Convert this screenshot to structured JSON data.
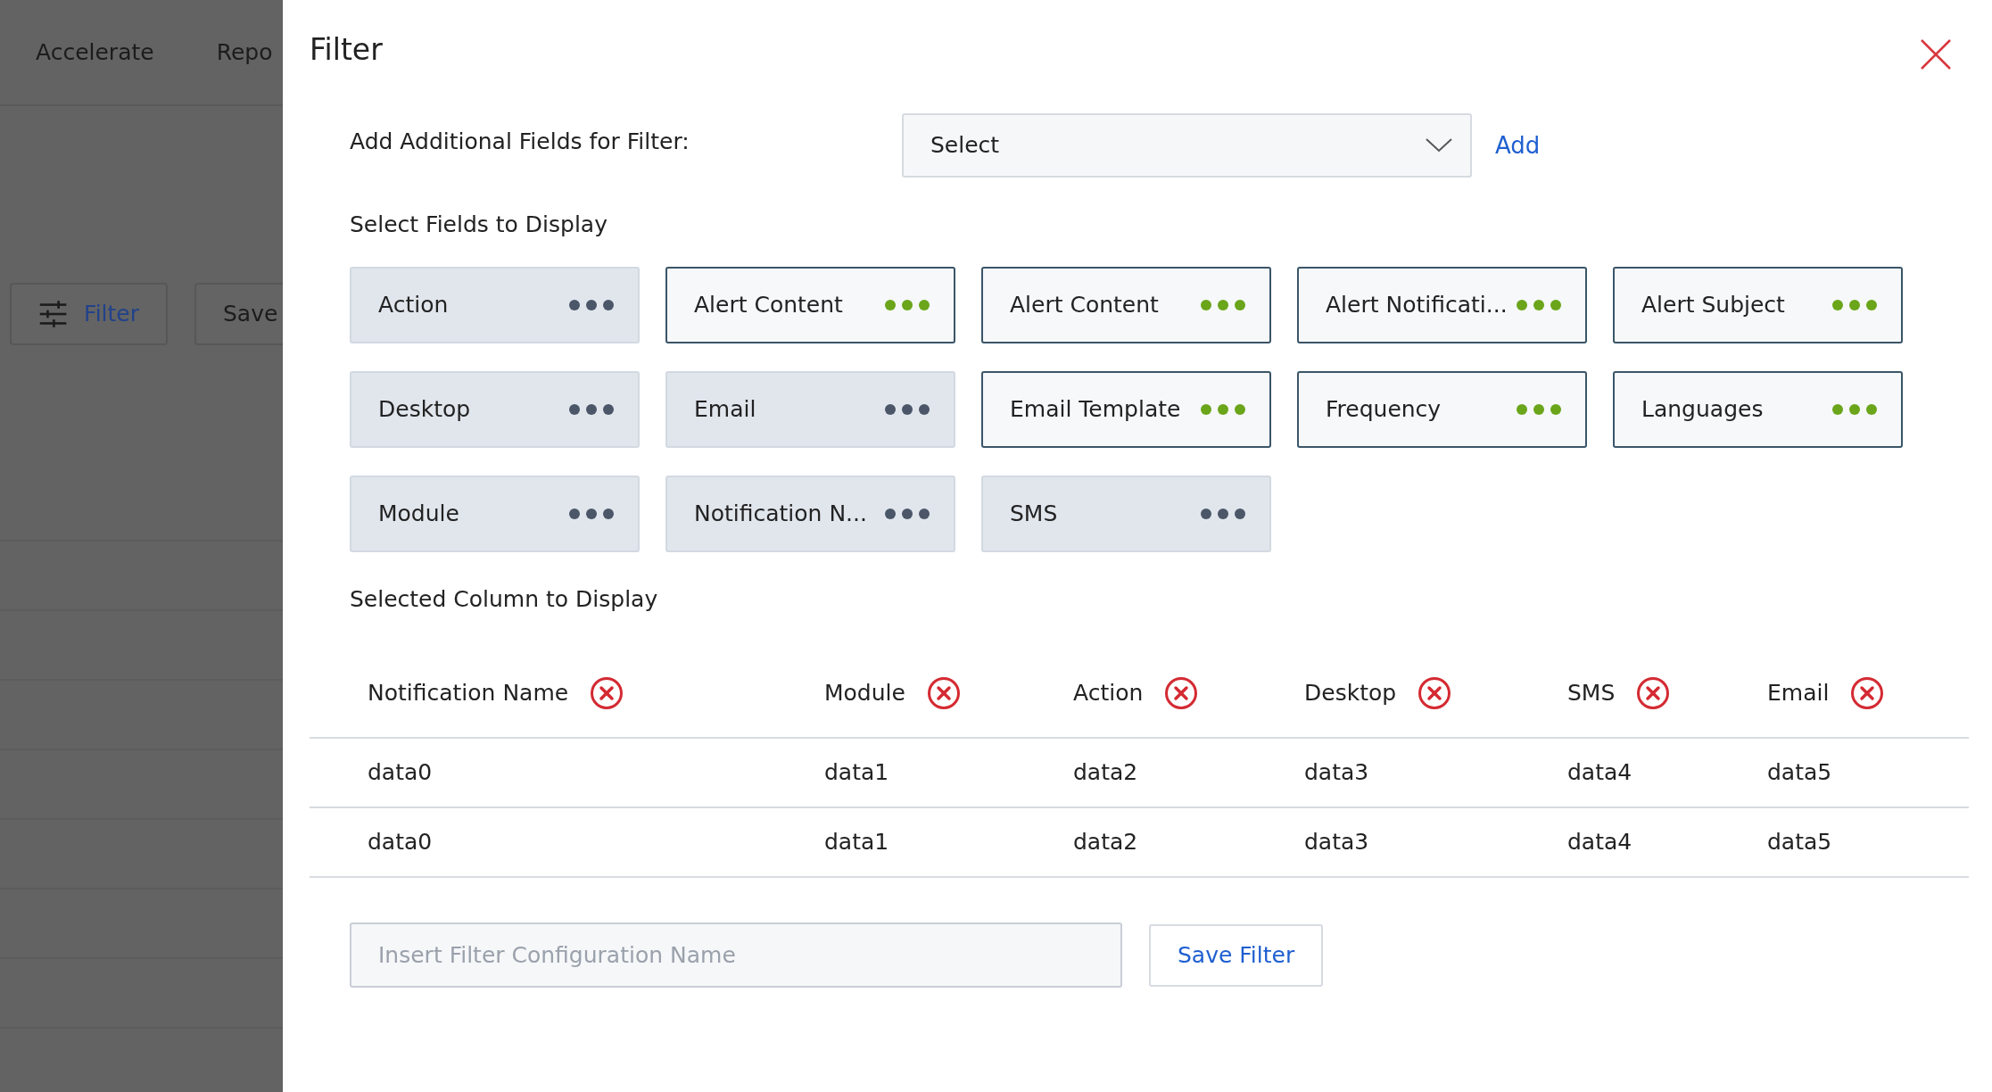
{
  "background": {
    "nav_items": [
      "Accelerate",
      "Repo"
    ],
    "buttons": [
      {
        "label": "Filter",
        "kind": "filter"
      },
      {
        "label": "Save",
        "kind": "plain"
      }
    ]
  },
  "dialog": {
    "title": "Filter",
    "add_fields": {
      "label": "Add Additional Fields for Filter:",
      "select": {
        "value": "Select"
      },
      "add_link": "Add"
    },
    "fields_heading": "Select Fields to Display",
    "fields": [
      {
        "label": "Action",
        "selected": false
      },
      {
        "label": "Alert Content",
        "selected": true
      },
      {
        "label": "Alert Content",
        "selected": true
      },
      {
        "label": "Alert Notificati...",
        "selected": true
      },
      {
        "label": "Alert Subject",
        "selected": true
      },
      {
        "label": "Desktop",
        "selected": false
      },
      {
        "label": "Email",
        "selected": false
      },
      {
        "label": "Email Template",
        "selected": true
      },
      {
        "label": "Frequency",
        "selected": true
      },
      {
        "label": "Languages",
        "selected": true
      },
      {
        "label": "Module",
        "selected": false
      },
      {
        "label": "Notification N...",
        "selected": false
      },
      {
        "label": "SMS",
        "selected": false
      }
    ],
    "columns_heading": "Selected Column to Display",
    "table": {
      "columns": [
        "Notification Name",
        "Module",
        "Action",
        "Desktop",
        "SMS",
        "Email"
      ],
      "rows": [
        [
          "data0",
          "data1",
          "data2",
          "data3",
          "data4",
          "data5"
        ],
        [
          "data0",
          "data1",
          "data2",
          "data3",
          "data4",
          "data5"
        ]
      ]
    },
    "footer": {
      "name_field": {
        "placeholder": "Insert Filter Configuration Name"
      },
      "save_button": "Save Filter"
    }
  }
}
